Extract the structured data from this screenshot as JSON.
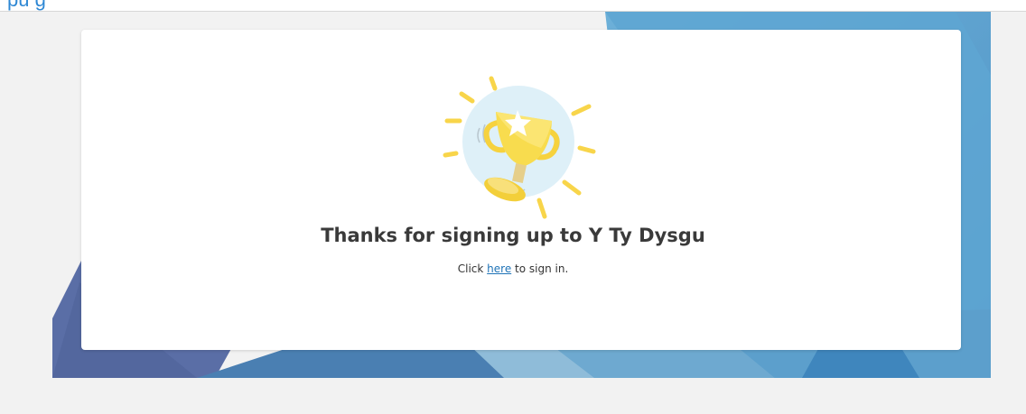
{
  "header": {
    "title_fragment": "pu     g"
  },
  "confirmation": {
    "heading": "Thanks for signing up to Y Ty Dysgu",
    "prefix": "Click ",
    "link_label": "here",
    "suffix": " to sign in."
  },
  "colors": {
    "background": "#f2f2f2",
    "card": "#ffffff",
    "link": "#1f73b7",
    "heading": "#3a3a3a",
    "hero_dark": "#4a6aa0",
    "hero_mid": "#4f8ec0",
    "hero_light": "#6aaed6"
  },
  "icons": {
    "illustration": "trophy-icon"
  }
}
